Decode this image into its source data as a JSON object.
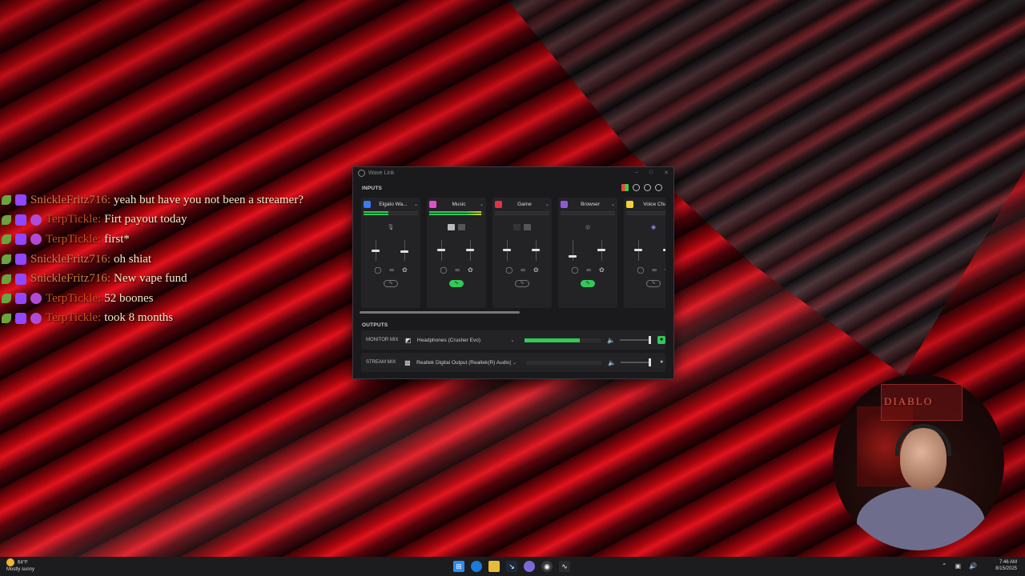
{
  "chat": [
    {
      "user": "SnickleFritz716:",
      "message": "yeah but have you not been a streamer?",
      "badges": "leaf-twitch"
    },
    {
      "user": "TerpTickle:",
      "message": "Firt payout today",
      "badges": "leaf-twitch-sub"
    },
    {
      "user": "TerpTickle:",
      "message": "first*",
      "badges": "leaf-twitch-sub"
    },
    {
      "user": "SnickleFritz716:",
      "message": "oh shiat",
      "badges": "leaf-twitch"
    },
    {
      "user": "SnickleFritz716:",
      "message": "New vape fund",
      "badges": "leaf-twitch"
    },
    {
      "user": "TerpTickle:",
      "message": "52 boones",
      "badges": "leaf-twitch-sub"
    },
    {
      "user": "TerpTickle:",
      "message": "took 8 months",
      "badges": "leaf-twitch-sub"
    }
  ],
  "wave_link": {
    "title": "Wave Link",
    "inputs_label": "INPUTS",
    "outputs_label": "OUTPUTS",
    "channels": [
      {
        "name": "Elgato Wa...",
        "icon_color": "#3b7bf0",
        "level": 0.45,
        "monitor_level": 0.45,
        "stream_level": 0.4,
        "link_on": false
      },
      {
        "name": "Music",
        "icon_color": "#e24fc9",
        "level": 0.95,
        "monitor_level": 0.5,
        "stream_level": 0.5,
        "link_on": true
      },
      {
        "name": "Game",
        "icon_color": "#e0334a",
        "level": 0,
        "monitor_level": 0.5,
        "stream_level": 0.5,
        "link_on": false
      },
      {
        "name": "Browser",
        "icon_color": "#8e5bd8",
        "level": 0,
        "monitor_level": 0.15,
        "stream_level": 0.5,
        "link_on": true
      },
      {
        "name": "Voice Chat",
        "icon_color": "#f2d13a",
        "level": 0,
        "monitor_level": 0.5,
        "stream_level": 0.5,
        "link_on": false
      }
    ],
    "outputs": [
      {
        "label": "MONITOR MIX",
        "device": "Headphones (Crusher Evo)",
        "icon": "headphones-icon",
        "level": 0.73,
        "volume": 1.0,
        "active": true
      },
      {
        "label": "STREAM MIX",
        "device": "Realtek Digital Output (Realtek(R) Audio)",
        "icon": "speaker-device-icon",
        "level": 0,
        "volume": 1.0,
        "active": false
      }
    ]
  },
  "webcam": {
    "sign_text": "DIABLO"
  },
  "taskbar": {
    "weather_temp": "64°F",
    "weather_desc": "Mostly sunny",
    "time": "7:46 AM",
    "date": "8/15/2025"
  }
}
